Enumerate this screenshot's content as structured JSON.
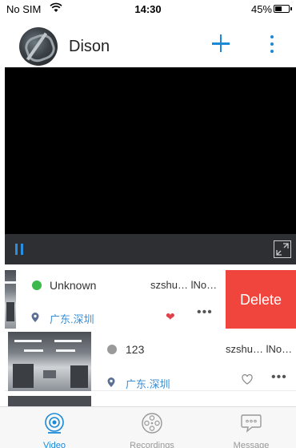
{
  "status_bar": {
    "carrier": "No SIM",
    "time": "14:30",
    "battery": "45%"
  },
  "header": {
    "username": "Dison"
  },
  "devices": [
    {
      "name": "Unknown",
      "id": "szshu… lNo…",
      "status_color": "#3cb94a",
      "location": "广东.深圳",
      "favorite": true,
      "delete_label": "Delete"
    },
    {
      "name": "123",
      "id": "szshu… lNo…",
      "status_color": "#9a9a9a",
      "location": "广东.深圳",
      "favorite": false
    }
  ],
  "tabs": [
    {
      "label": "Video",
      "icon": "camera-icon",
      "active": true
    },
    {
      "label": "Recordings",
      "icon": "film-reel-icon",
      "active": false
    },
    {
      "label": "Message",
      "icon": "chat-bubble-icon",
      "active": false
    }
  ],
  "colors": {
    "accent": "#1a8ad8",
    "delete": "#f0453c",
    "favorite": "#e0424a"
  }
}
